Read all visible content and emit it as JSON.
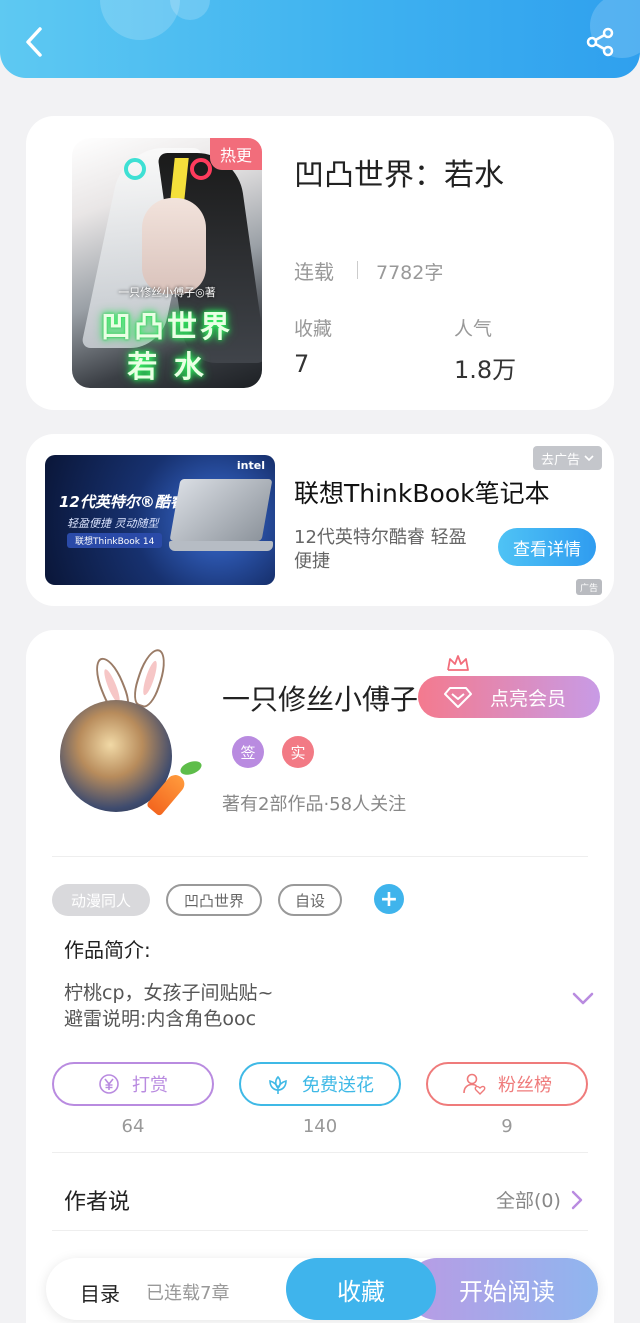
{
  "header": {
    "back_icon": "chevron-left-icon",
    "share_icon": "share-icon",
    "background": "#3fb2f0"
  },
  "book": {
    "title": "凹凸世界：若水",
    "badge": "热更",
    "status": "连载",
    "word_count": "7782字",
    "favorites_label": "收藏",
    "favorites_value": "7",
    "popularity_label": "人气",
    "popularity_value": "1.8万",
    "cover": {
      "author_line": "一只修丝小傅子◎著",
      "title_line1": "凹凸世界",
      "title_line2": "若 水"
    }
  },
  "ad": {
    "close_label": "去广告",
    "title": "联想ThinkBook笔记本",
    "description": "12代英特尔酷睿 轻盈便捷",
    "button_label": "查看详情",
    "mark_label": "广告",
    "image": {
      "brand": "intel",
      "headline": "12代英特尔®酷睿™",
      "subline": "轻盈便捷 灵动随型",
      "product": "联想ThinkBook 14"
    }
  },
  "author": {
    "name": "一只修丝小傅子",
    "vip_button": "点亮会员",
    "badges": [
      {
        "label": "签",
        "color": "#b98be0"
      },
      {
        "label": "实",
        "color": "#f27a85"
      }
    ],
    "meta": "著有2部作品·58人关注"
  },
  "tags": [
    "动漫同人",
    "凹凸世界",
    "自设"
  ],
  "intro": {
    "label": "作品简介:",
    "lines": [
      "柠桃cp，女孩子间贴贴~",
      "避雷说明:内含角色ooc"
    ]
  },
  "actions": [
    {
      "label": "打赏",
      "count": "64",
      "color": "#b98be0",
      "icon": "yen-icon"
    },
    {
      "label": "免费送花",
      "count": "140",
      "color": "#3fb9e6",
      "icon": "flower-icon"
    },
    {
      "label": "粉丝榜",
      "count": "9",
      "color": "#ef7b7b",
      "icon": "user-heart-icon"
    }
  ],
  "author_says": {
    "label": "作者说",
    "all_label": "全部(0)"
  },
  "bottom_bar": {
    "toc_label": "目录",
    "chapters_label": "已连载7章",
    "collect_label": "收藏",
    "read_label": "开始阅读"
  }
}
